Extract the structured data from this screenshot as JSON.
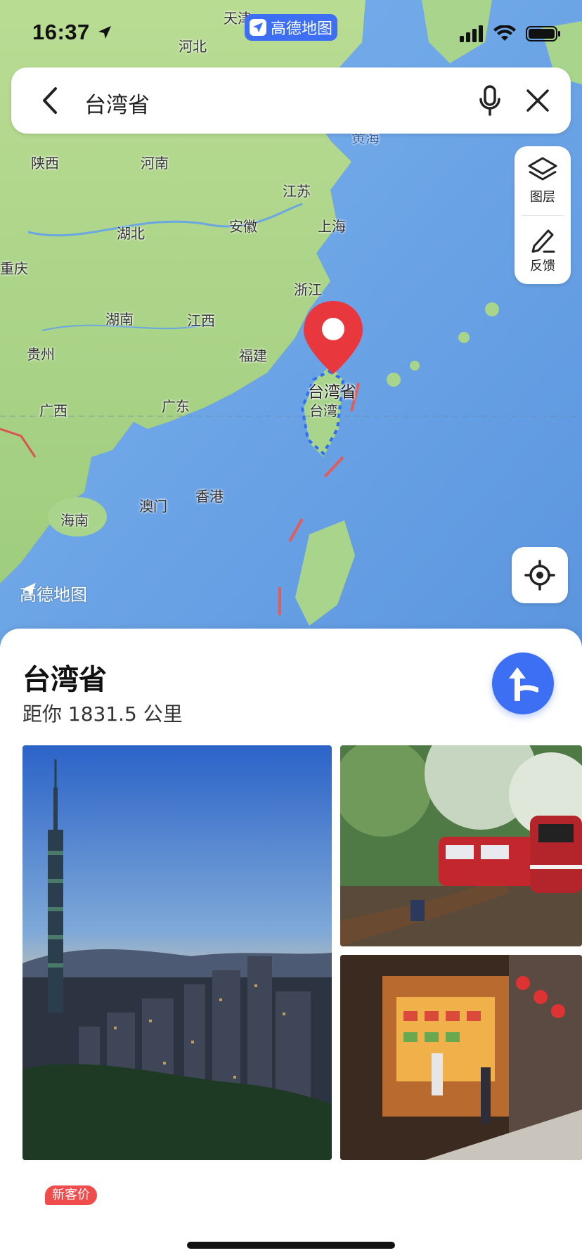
{
  "status_bar": {
    "time": "16:37",
    "brand_badge": "高德地图"
  },
  "search": {
    "query": "台湾省"
  },
  "map_controls": {
    "layers_label": "图层",
    "feedback_label": "反馈"
  },
  "map_labels": {
    "tianjin": "天津",
    "hebei": "河北",
    "shaanxi": "陕西",
    "henan": "河南",
    "jiangsu": "江苏",
    "anhui": "安徽",
    "shanghai": "上海",
    "hubei": "湖北",
    "chongqing": "重庆",
    "zhejiang": "浙江",
    "hunan": "湖南",
    "jiangxi": "江西",
    "guizhou": "贵州",
    "fujian": "福建",
    "guangxi": "广西",
    "guangdong": "广东",
    "macau": "澳门",
    "hongkong": "香港",
    "hainan": "海南",
    "huanghai": "黄海",
    "taiwan_province": "台湾省",
    "taiwan": "台湾"
  },
  "map_watermark": "高德地图",
  "place": {
    "name": "台湾省",
    "distance": "距你 1831.5 公里"
  },
  "bottom_nav": {
    "badge": "新客价",
    "items": [
      {
        "icon": "hotel-icon",
        "color": "#4a6fe8",
        "bg": "#e8eefc"
      },
      {
        "icon": "scenic-gate-icon",
        "color": "#2bb58a",
        "bg": "#e4f6ef"
      },
      {
        "icon": "bookmark-icon",
        "color": "#f0485a",
        "bg": "#fde8ea"
      },
      {
        "icon": "flight-icon",
        "color": "#4a6fe8",
        "bg": "#e8eefc"
      },
      {
        "icon": "train-icon",
        "color": "#2bb58a",
        "bg": "#e4f6ef"
      }
    ]
  },
  "colors": {
    "accent": "#3d6ff4",
    "pin": "#e8383d",
    "land": "#a9d38a",
    "sea": "#6fa8e8"
  }
}
